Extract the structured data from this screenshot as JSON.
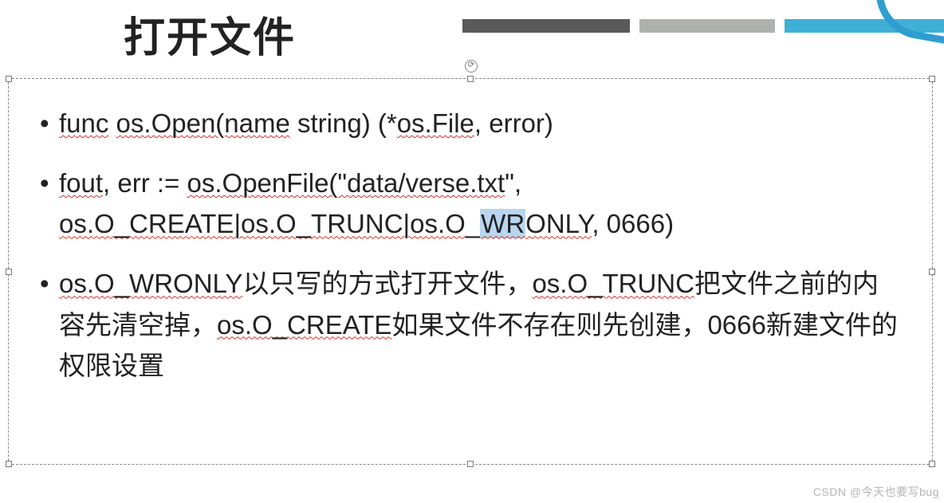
{
  "title": "打开文件",
  "bullets": {
    "b1": {
      "p1": "func",
      "p2": "os.Open(name",
      "p3": " string) (*",
      "p4": "os.File",
      "p5": ", error)"
    },
    "b2": {
      "p1": "fout",
      "p2": ", err := ",
      "p3": "os.OpenFile(\"data/verse.txt",
      "p4": "\", ",
      "p5": "os.O_CREATE|os.O_TRUNC|os.O",
      "p6": "_",
      "p6hl": "WR",
      "p7": "ONLY",
      "p8": ", 0666)"
    },
    "b3": {
      "p1": "os.O_WRONLY",
      "p2": "以只写的方式打开文件，",
      "p3": "os.O_TRUNC",
      "p4": "把文件之前的内容先清空掉，",
      "p5": "os.O_CREATE",
      "p6": "如果文件不存在则先创建，0666新建文件的权限设置"
    }
  },
  "watermark": "CSDN @今天也要写bug"
}
